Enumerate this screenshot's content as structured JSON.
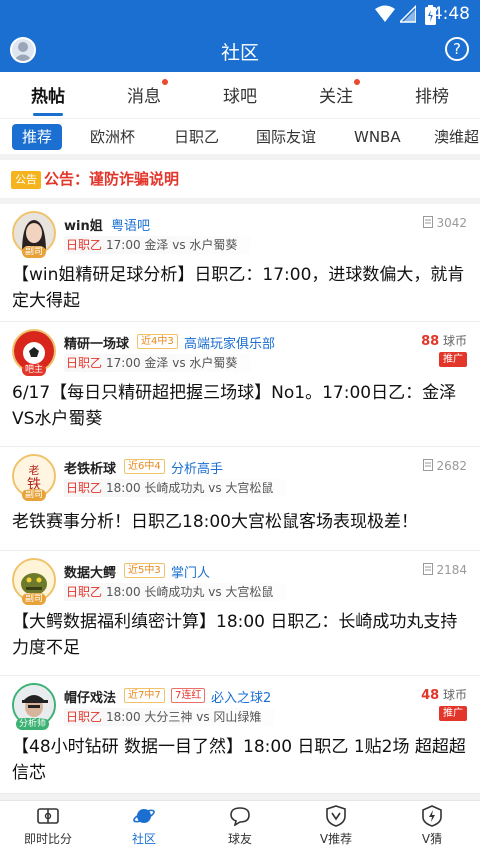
{
  "status_bar": {
    "time": "4:48"
  },
  "app_bar": {
    "title": "社区",
    "help_label": "?"
  },
  "tabs": [
    {
      "label": "热帖",
      "active": true,
      "dot": false
    },
    {
      "label": "消息",
      "active": false,
      "dot": true
    },
    {
      "label": "球吧",
      "active": false,
      "dot": false
    },
    {
      "label": "关注",
      "active": false,
      "dot": true
    },
    {
      "label": "排榜",
      "active": false,
      "dot": false
    }
  ],
  "subtabs": [
    {
      "label": "推荐",
      "active": true
    },
    {
      "label": "欧洲杯",
      "active": false
    },
    {
      "label": "日职乙",
      "active": false
    },
    {
      "label": "国际友谊",
      "active": false
    },
    {
      "label": "WNBA",
      "active": false
    },
    {
      "label": "澳维超",
      "active": false
    }
  ],
  "notice": {
    "badge": "公告",
    "text": "公告：谨防诈骗说明"
  },
  "posts": [
    {
      "name": "win姐",
      "role": "副司",
      "club": "粤语吧",
      "views": "3042",
      "match_league": "日职乙",
      "match_info": "17:00 金泽 vs 水户蜀葵",
      "body": "【win姐精研足球分析】日职乙：17:00，进球数偏大，就肯定大得起"
    },
    {
      "name": "精研一场球",
      "role": "吧主",
      "tag": "近4中3",
      "club": "高端玩家俱乐部",
      "coin_value": "88",
      "coin_unit": "球币",
      "promo": "推广",
      "match_league": "日职乙",
      "match_info": "17:00 金泽 vs 水户蜀葵",
      "body": "6/17【每日只精研超把握三场球】No1。17:00日乙：金泽VS水户蜀葵"
    },
    {
      "name": "老铁析球",
      "role": "副司",
      "tag": "近6中4",
      "club": "分析高手",
      "views": "2682",
      "match_league": "日职乙",
      "match_info": "18:00 长崎成功丸 vs 大宫松鼠",
      "body": "老铁赛事分析！日职乙18:00大宫松鼠客场表现极差！"
    },
    {
      "name": "数据大鳄",
      "role": "副司",
      "tag": "近5中3",
      "club": "掌门人",
      "views": "2184",
      "match_league": "日职乙",
      "match_info": "18:00 长崎成功丸 vs 大宫松鼠",
      "body": "【大鳄数据福利缜密计算】18:00 日职乙：长崎成功丸支持力度不足"
    },
    {
      "name": "帽仔戏法",
      "role": "分析师",
      "tag": "近7中7",
      "tag2": "7连红",
      "club": "必入之球2",
      "coin_value": "48",
      "coin_unit": "球币",
      "promo": "推广",
      "match_league": "日职乙",
      "match_info": "18:00 大分三神 vs 冈山绿雉",
      "body": "【48小时钻研 数据一目了然】18:00 日职乙 1贴2场 超超超信芯"
    }
  ],
  "bottom_nav": [
    {
      "label": "即时比分",
      "icon": "scoreboard-icon",
      "active": false
    },
    {
      "label": "社区",
      "icon": "planet-icon",
      "active": true
    },
    {
      "label": "球友",
      "icon": "chat-bubble-icon",
      "active": false
    },
    {
      "label": "V推荐",
      "icon": "v-shield-icon",
      "active": false
    },
    {
      "label": "V猜",
      "icon": "lightning-icon",
      "active": false
    }
  ],
  "colors": {
    "primary": "#1a6fd1",
    "alert": "#e3362b",
    "gold": "#f0c36a"
  }
}
